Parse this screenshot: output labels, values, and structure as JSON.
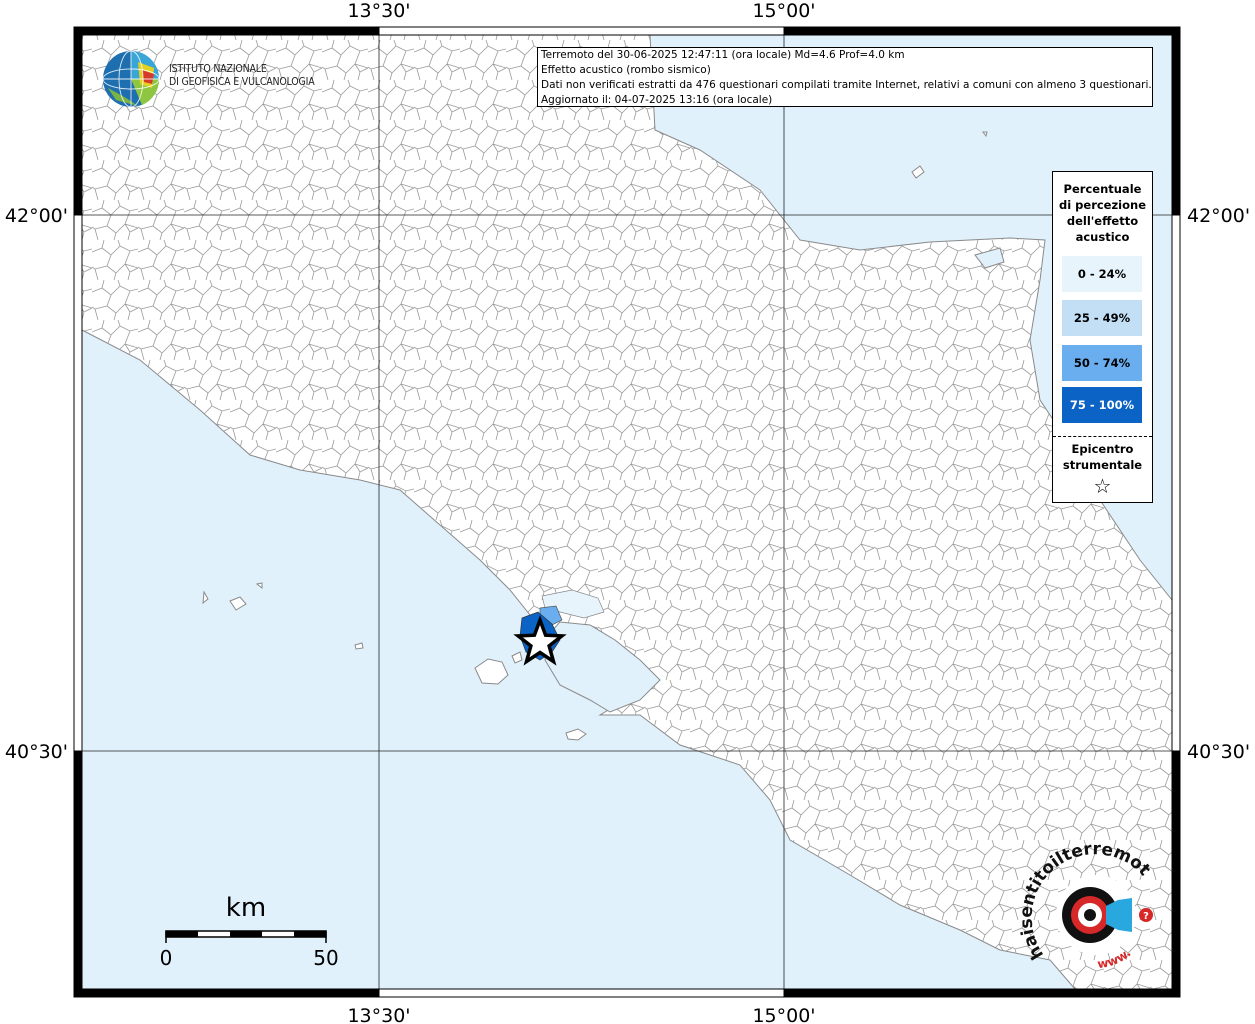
{
  "frame": {
    "top_ticks": [
      "13°30'",
      "15°00'"
    ],
    "bottom_ticks": [
      "13°30'",
      "15°00'"
    ],
    "left_ticks": [
      "42°00'",
      "40°30'"
    ],
    "right_ticks": [
      "42°00'",
      "40°30'"
    ]
  },
  "info": {
    "line1": "Terremoto del 30-06-2025 12:47:11 (ora locale) Md=4.6 Prof=4.0 km",
    "line2": "Effetto acustico (rombo sismico)",
    "line3": "Dati non verificati estratti da 476 questionari compilati tramite Internet, relativi a comuni con almeno 3 questionari.",
    "line4": "Aggiornato il: 04-07-2025 13:16 (ora locale)"
  },
  "logo": {
    "line1": "ISTITUTO NAZIONALE",
    "line2": "DI GEOFISICA E VULCANOLOGIA"
  },
  "legend": {
    "title_lines": [
      "Percentuale",
      "di percezione",
      "dell'effetto",
      "acustico"
    ],
    "classes": [
      {
        "label": "0 - 24%",
        "color": "#e8f4fc",
        "text_color": "#000000"
      },
      {
        "label": "25 - 49%",
        "color": "#c2dff6",
        "text_color": "#000000"
      },
      {
        "label": "50 - 74%",
        "color": "#6aaef0",
        "text_color": "#000000"
      },
      {
        "label": "75 - 100%",
        "color": "#0b63c6",
        "text_color": "#ffffff"
      }
    ],
    "epicenter_lines": [
      "Epicentro",
      "strumentale"
    ],
    "epicenter_symbol": "☆"
  },
  "scale_bar": {
    "unit": "km",
    "start_label": "0",
    "end_label": "50"
  },
  "badge": {
    "top_text": "haisentitoilterremoto.it",
    "bottom_text": "www.",
    "icon": "speaker-target-icon"
  },
  "colors": {
    "sea": "#e0f1fc",
    "land": "#ffffff",
    "borders": "#8a8a8a",
    "frame": "#000000"
  }
}
